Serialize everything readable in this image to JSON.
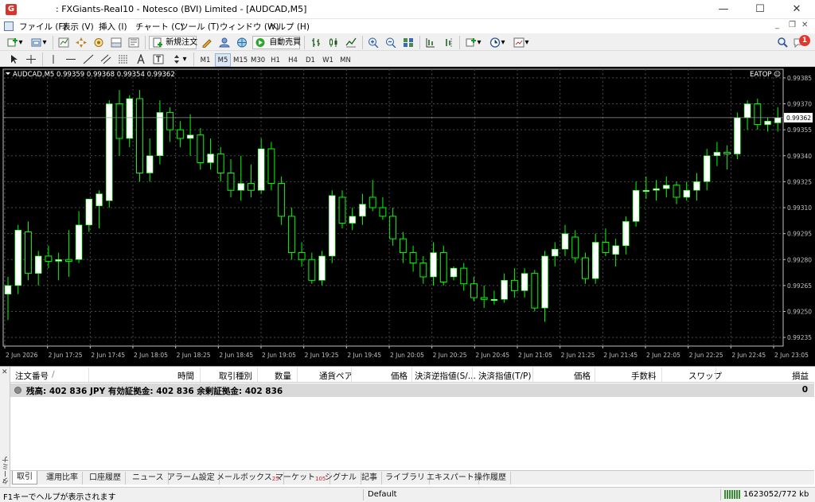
{
  "window": {
    "title": ": FXGiants-Real10 - Notesco (BVI) Limited - [AUDCAD,M5]",
    "logo": "G",
    "minimize": "—",
    "maximize": "☐",
    "close": "✕"
  },
  "menu": {
    "items": [
      "ファイル (F)",
      "表示 (V)",
      "挿入 (I)",
      "チャート (C)",
      "ツール (T)",
      "ウィンドウ (W)",
      "ヘルプ (H)"
    ],
    "mdi_minimize": "_",
    "mdi_restore": "❐",
    "mdi_close": "✕"
  },
  "toolbar": {
    "new_order": "新規注文",
    "auto_trading": "自動売買",
    "notification_count": "1"
  },
  "timeframes": {
    "items": [
      "M1",
      "M5",
      "M15",
      "M30",
      "H1",
      "H4",
      "D1",
      "W1",
      "MN"
    ],
    "active": "M5"
  },
  "chart": {
    "symbol_info": "AUDCAD,M5  0.99359 0.99368 0.99354 0.99362",
    "ea_label": "EATOP ☺",
    "current_price": "0.99362",
    "colors": {
      "background": "#000000",
      "bull_body": "#ffffff",
      "wick": "#00ff00",
      "grid": "#4a4a4a",
      "axis": "#c0c0c0"
    }
  },
  "chart_data": {
    "type": "candlestick",
    "symbol": "AUDCAD",
    "timeframe": "M5",
    "ylim": [
      0.9923,
      0.9939
    ],
    "y_ticks": [
      "0.99385",
      "0.99370",
      "0.99355",
      "0.99340",
      "0.99325",
      "0.99310",
      "0.99295",
      "0.99280",
      "0.99265",
      "0.99250",
      "0.99235"
    ],
    "x_ticks": [
      "2 Jun 2026",
      "2 Jun 17:25",
      "2 Jun 17:45",
      "2 Jun 18:05",
      "2 Jun 18:25",
      "2 Jun 18:45",
      "2 Jun 19:05",
      "2 Jun 19:25",
      "2 Jun 19:45",
      "2 Jun 20:05",
      "2 Jun 20:25",
      "2 Jun 20:45",
      "2 Jun 21:05",
      "2 Jun 21:25",
      "2 Jun 21:45",
      "2 Jun 22:05",
      "2 Jun 22:25",
      "2 Jun 22:45",
      "2 Jun 23:05"
    ],
    "candles": [
      {
        "o": 0.9926,
        "h": 0.9927,
        "l": 0.99245,
        "c": 0.99265
      },
      {
        "o": 0.99265,
        "h": 0.993,
        "l": 0.9926,
        "c": 0.99297
      },
      {
        "o": 0.99296,
        "h": 0.99302,
        "l": 0.99268,
        "c": 0.99272
      },
      {
        "o": 0.99272,
        "h": 0.99285,
        "l": 0.99265,
        "c": 0.99282
      },
      {
        "o": 0.99282,
        "h": 0.99288,
        "l": 0.99275,
        "c": 0.99279
      },
      {
        "o": 0.99279,
        "h": 0.99284,
        "l": 0.99268,
        "c": 0.9928
      },
      {
        "o": 0.9928,
        "h": 0.99297,
        "l": 0.9927,
        "c": 0.99279
      },
      {
        "o": 0.9928,
        "h": 0.99308,
        "l": 0.99278,
        "c": 0.993
      },
      {
        "o": 0.993,
        "h": 0.99315,
        "l": 0.99296,
        "c": 0.99315
      },
      {
        "o": 0.99311,
        "h": 0.9932,
        "l": 0.99298,
        "c": 0.99318
      },
      {
        "o": 0.99314,
        "h": 0.99372,
        "l": 0.9931,
        "c": 0.9937
      },
      {
        "o": 0.9937,
        "h": 0.99378,
        "l": 0.9934,
        "c": 0.9935
      },
      {
        "o": 0.9935,
        "h": 0.99375,
        "l": 0.99345,
        "c": 0.99373
      },
      {
        "o": 0.99373,
        "h": 0.99378,
        "l": 0.99325,
        "c": 0.9933
      },
      {
        "o": 0.9933,
        "h": 0.9935,
        "l": 0.99325,
        "c": 0.9934
      },
      {
        "o": 0.9934,
        "h": 0.99372,
        "l": 0.99335,
        "c": 0.99365
      },
      {
        "o": 0.99365,
        "h": 0.99368,
        "l": 0.99348,
        "c": 0.99355
      },
      {
        "o": 0.99355,
        "h": 0.9936,
        "l": 0.99345,
        "c": 0.9935
      },
      {
        "o": 0.9935,
        "h": 0.99364,
        "l": 0.9934,
        "c": 0.99352
      },
      {
        "o": 0.99352,
        "h": 0.99356,
        "l": 0.99332,
        "c": 0.99336
      },
      {
        "o": 0.99336,
        "h": 0.9935,
        "l": 0.99332,
        "c": 0.99341
      },
      {
        "o": 0.99341,
        "h": 0.99345,
        "l": 0.99325,
        "c": 0.9933
      },
      {
        "o": 0.9933,
        "h": 0.99338,
        "l": 0.99316,
        "c": 0.9932
      },
      {
        "o": 0.9932,
        "h": 0.9934,
        "l": 0.99314,
        "c": 0.99324
      },
      {
        "o": 0.99324,
        "h": 0.99335,
        "l": 0.99316,
        "c": 0.9932
      },
      {
        "o": 0.9932,
        "h": 0.9935,
        "l": 0.99318,
        "c": 0.99344
      },
      {
        "o": 0.99344,
        "h": 0.99348,
        "l": 0.9932,
        "c": 0.99324
      },
      {
        "o": 0.99324,
        "h": 0.99328,
        "l": 0.993,
        "c": 0.99305
      },
      {
        "o": 0.99305,
        "h": 0.9931,
        "l": 0.9928,
        "c": 0.99284
      },
      {
        "o": 0.99284,
        "h": 0.9929,
        "l": 0.99276,
        "c": 0.9928
      },
      {
        "o": 0.9928,
        "h": 0.99284,
        "l": 0.99266,
        "c": 0.99268
      },
      {
        "o": 0.99268,
        "h": 0.99285,
        "l": 0.99265,
        "c": 0.99282
      },
      {
        "o": 0.99282,
        "h": 0.9932,
        "l": 0.99278,
        "c": 0.99317
      },
      {
        "o": 0.99316,
        "h": 0.9932,
        "l": 0.99298,
        "c": 0.99301
      },
      {
        "o": 0.99301,
        "h": 0.9931,
        "l": 0.99297,
        "c": 0.99305
      },
      {
        "o": 0.99305,
        "h": 0.99318,
        "l": 0.993,
        "c": 0.99312
      },
      {
        "o": 0.99316,
        "h": 0.99326,
        "l": 0.99308,
        "c": 0.9931
      },
      {
        "o": 0.9931,
        "h": 0.99316,
        "l": 0.99303,
        "c": 0.99305
      },
      {
        "o": 0.99305,
        "h": 0.9931,
        "l": 0.99288,
        "c": 0.99292
      },
      {
        "o": 0.99292,
        "h": 0.99296,
        "l": 0.99278,
        "c": 0.99284
      },
      {
        "o": 0.99284,
        "h": 0.99288,
        "l": 0.99273,
        "c": 0.99278
      },
      {
        "o": 0.99278,
        "h": 0.99282,
        "l": 0.99266,
        "c": 0.9927
      },
      {
        "o": 0.9927,
        "h": 0.9929,
        "l": 0.99265,
        "c": 0.99284
      },
      {
        "o": 0.99284,
        "h": 0.99288,
        "l": 0.99265,
        "c": 0.99267
      },
      {
        "o": 0.9927,
        "h": 0.99276,
        "l": 0.99268,
        "c": 0.99275
      },
      {
        "o": 0.99275,
        "h": 0.99278,
        "l": 0.99262,
        "c": 0.99266
      },
      {
        "o": 0.99266,
        "h": 0.9927,
        "l": 0.99256,
        "c": 0.99258
      },
      {
        "o": 0.99258,
        "h": 0.99265,
        "l": 0.99252,
        "c": 0.99257
      },
      {
        "o": 0.99257,
        "h": 0.99262,
        "l": 0.99254,
        "c": 0.99257
      },
      {
        "o": 0.99257,
        "h": 0.99272,
        "l": 0.99255,
        "c": 0.99268
      },
      {
        "o": 0.99268,
        "h": 0.99275,
        "l": 0.99258,
        "c": 0.99262
      },
      {
        "o": 0.99262,
        "h": 0.99275,
        "l": 0.99258,
        "c": 0.99272
      },
      {
        "o": 0.99272,
        "h": 0.99274,
        "l": 0.9925,
        "c": 0.99252
      },
      {
        "o": 0.99252,
        "h": 0.99285,
        "l": 0.99244,
        "c": 0.99282
      },
      {
        "o": 0.99282,
        "h": 0.9929,
        "l": 0.99276,
        "c": 0.99286
      },
      {
        "o": 0.99286,
        "h": 0.993,
        "l": 0.99282,
        "c": 0.99295
      },
      {
        "o": 0.99293,
        "h": 0.99297,
        "l": 0.99278,
        "c": 0.99281
      },
      {
        "o": 0.99281,
        "h": 0.99284,
        "l": 0.99266,
        "c": 0.99269
      },
      {
        "o": 0.99269,
        "h": 0.99295,
        "l": 0.99266,
        "c": 0.9929
      },
      {
        "o": 0.9929,
        "h": 0.99298,
        "l": 0.99282,
        "c": 0.99284
      },
      {
        "o": 0.99283,
        "h": 0.99292,
        "l": 0.99276,
        "c": 0.99288
      },
      {
        "o": 0.99288,
        "h": 0.99305,
        "l": 0.99283,
        "c": 0.99302
      },
      {
        "o": 0.99302,
        "h": 0.99325,
        "l": 0.99299,
        "c": 0.9932
      },
      {
        "o": 0.9932,
        "h": 0.99328,
        "l": 0.99315,
        "c": 0.9932
      },
      {
        "o": 0.9932,
        "h": 0.99326,
        "l": 0.99314,
        "c": 0.99321
      },
      {
        "o": 0.99321,
        "h": 0.99328,
        "l": 0.99316,
        "c": 0.99323
      },
      {
        "o": 0.99323,
        "h": 0.99325,
        "l": 0.99312,
        "c": 0.99316
      },
      {
        "o": 0.99316,
        "h": 0.99325,
        "l": 0.99314,
        "c": 0.9932
      },
      {
        "o": 0.9932,
        "h": 0.9933,
        "l": 0.99314,
        "c": 0.99325
      },
      {
        "o": 0.99325,
        "h": 0.99344,
        "l": 0.9932,
        "c": 0.9934
      },
      {
        "o": 0.9934,
        "h": 0.99348,
        "l": 0.99334,
        "c": 0.99342
      },
      {
        "o": 0.99342,
        "h": 0.99346,
        "l": 0.99332,
        "c": 0.99341
      },
      {
        "o": 0.99341,
        "h": 0.99365,
        "l": 0.99338,
        "c": 0.99362
      },
      {
        "o": 0.99362,
        "h": 0.99372,
        "l": 0.99355,
        "c": 0.9937
      },
      {
        "o": 0.9937,
        "h": 0.99373,
        "l": 0.99355,
        "c": 0.99358
      },
      {
        "o": 0.99358,
        "h": 0.99362,
        "l": 0.99354,
        "c": 0.9936
      },
      {
        "o": 0.99359,
        "h": 0.99368,
        "l": 0.99354,
        "c": 0.99362
      }
    ]
  },
  "terminal": {
    "side_close": "✕",
    "side_label": "ターミナル",
    "columns": [
      "注文番号",
      "/",
      "時間",
      "取引種別",
      "数量",
      "通貨ペア",
      "価格",
      "決済逆指値(S/...",
      "決済指値(T/P)",
      "価格",
      "手数料",
      "スワップ",
      "損益"
    ],
    "balance_text": "残高: 402 836 JPY  有効証拠金: 402 836  余剰証拠金: 402 836",
    "balance_pl": "0",
    "tabs": [
      {
        "label": "取引",
        "badge": ""
      },
      {
        "label": "運用比率",
        "badge": ""
      },
      {
        "label": "口座履歴",
        "badge": ""
      },
      {
        "label": "ニュース",
        "badge": ""
      },
      {
        "label": "アラーム設定",
        "badge": ""
      },
      {
        "label": "メールボックス",
        "badge": "25"
      },
      {
        "label": "マーケット",
        "badge": "105"
      },
      {
        "label": "シグナル",
        "badge": ""
      },
      {
        "label": "記事",
        "badge": ""
      },
      {
        "label": "ライブラリ",
        "badge": ""
      },
      {
        "label": "エキスパート",
        "badge": ""
      },
      {
        "label": "操作履歴",
        "badge": ""
      }
    ]
  },
  "status": {
    "help": "F1キーでヘルプが表示されます",
    "profile": "Default",
    "connection": "1623052/772 kb"
  }
}
